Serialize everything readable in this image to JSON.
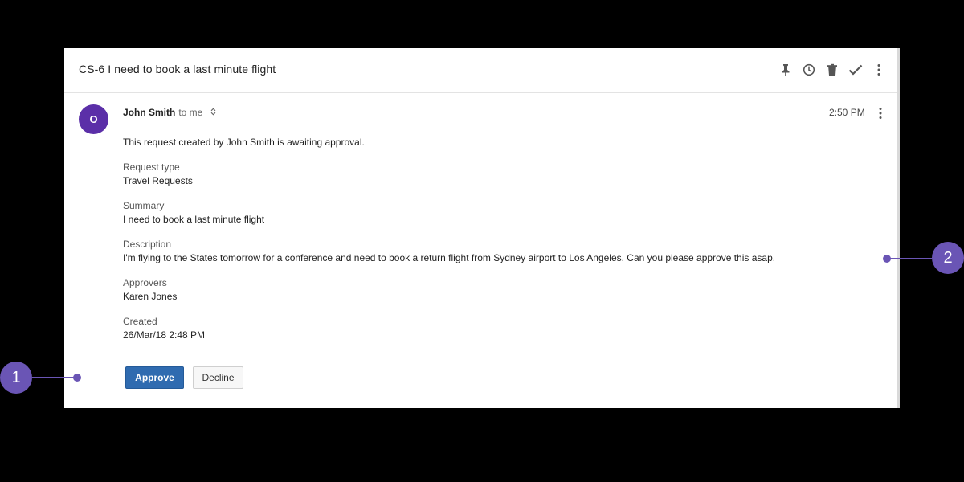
{
  "email": {
    "subject": "CS-6 I need to book a last minute flight",
    "toolbar_icons": [
      "pin-icon",
      "snooze-icon",
      "trash-icon",
      "check-icon",
      "more-vert-icon"
    ],
    "sender": {
      "avatar_initial": "O",
      "name": "John Smith",
      "recipient": "to me"
    },
    "time": "2:50 PM",
    "intro": "This request created by John Smith is awaiting approval.",
    "fields": [
      {
        "label": "Request type",
        "value": "Travel Requests"
      },
      {
        "label": "Summary",
        "value": "I need to book a last minute flight"
      },
      {
        "label": "Description",
        "value": "I'm flying to the States tomorrow for a conference and need to book a return flight from Sydney airport to Los Angeles. Can you please approve this asap."
      },
      {
        "label": "Approvers",
        "value": "Karen Jones"
      },
      {
        "label": "Created",
        "value": "26/Mar/18 2:48 PM"
      }
    ],
    "actions": {
      "approve_label": "Approve",
      "decline_label": "Decline"
    }
  },
  "callouts": [
    {
      "number": "1"
    },
    {
      "number": "2"
    }
  ],
  "colors": {
    "accent": "#6a55b5",
    "avatar": "#5b2fa8",
    "approve": "#2f6bb0"
  }
}
